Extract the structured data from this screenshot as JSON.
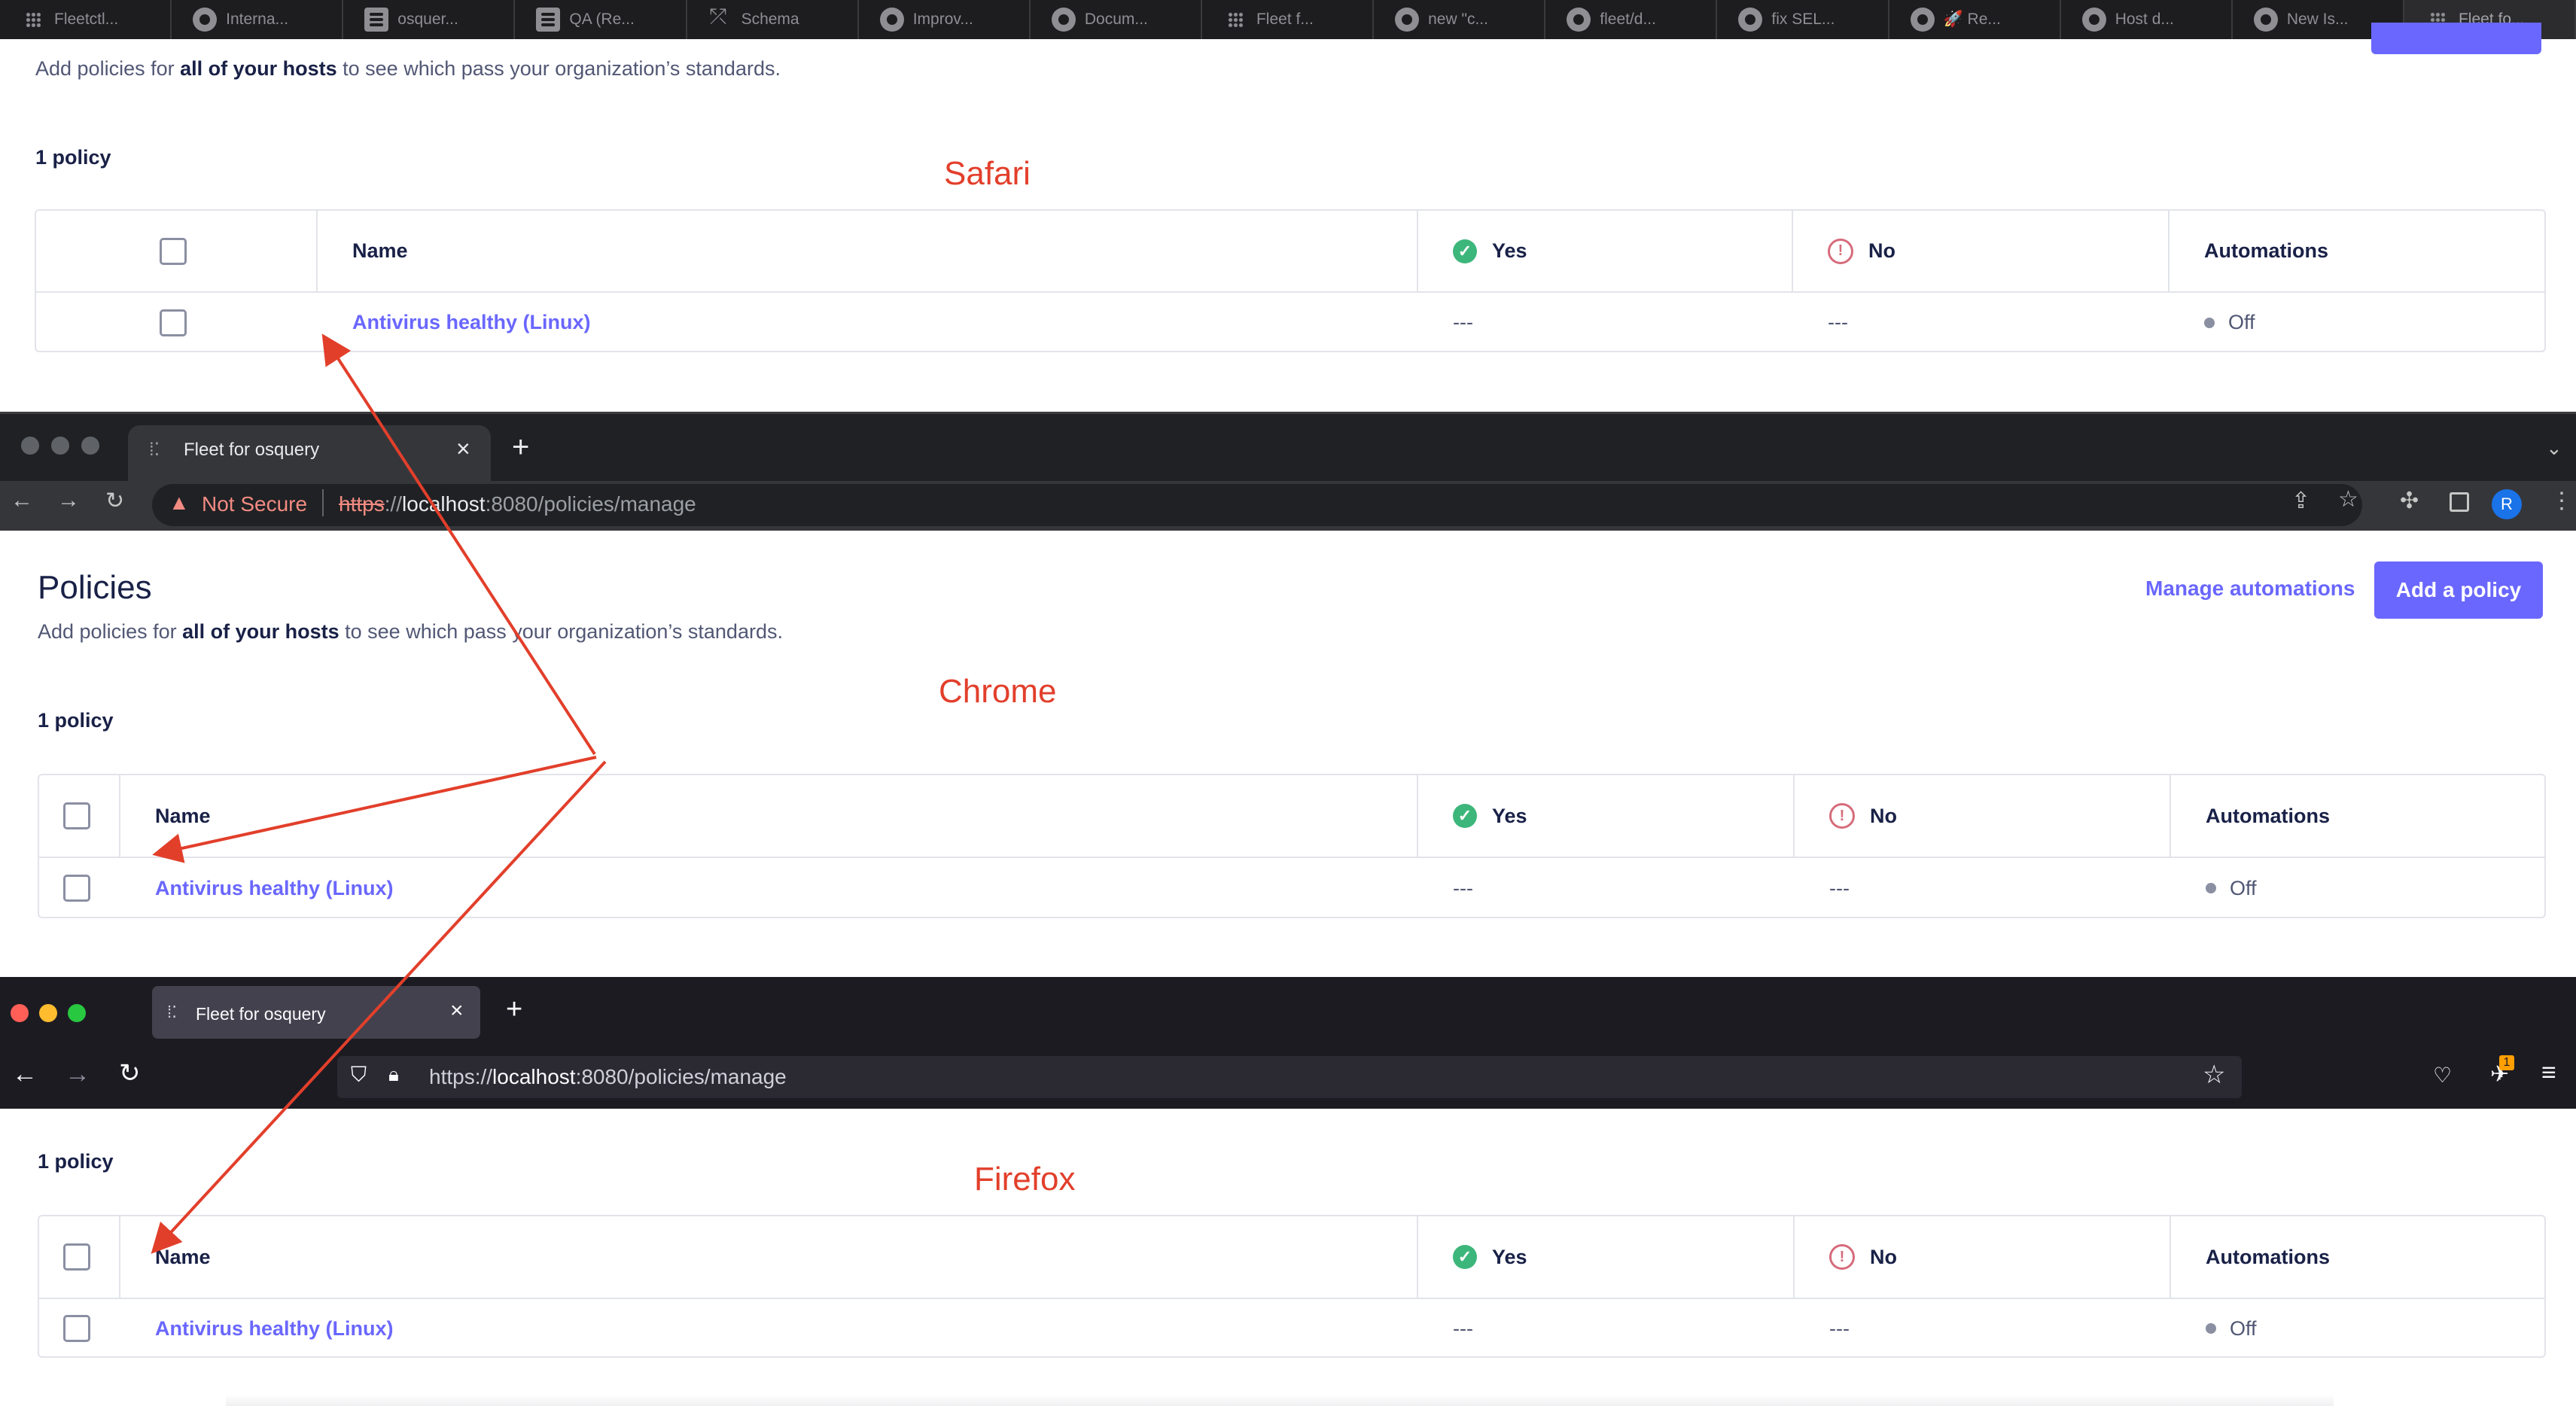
{
  "safari": {
    "tabs": [
      {
        "title": "Fleetctl...",
        "icon": "fleet-icon"
      },
      {
        "title": "Interna...",
        "icon": "github-icon"
      },
      {
        "title": "osquer...",
        "icon": "doc-icon"
      },
      {
        "title": "QA (Re...",
        "icon": "table-icon"
      },
      {
        "title": "Schema",
        "icon": "schema-icon"
      },
      {
        "title": "Improv...",
        "icon": "github-icon"
      },
      {
        "title": "Docum...",
        "icon": "github-icon"
      },
      {
        "title": "Fleet f...",
        "icon": "fleet-icon"
      },
      {
        "title": "new \"c...",
        "icon": "github-icon"
      },
      {
        "title": "fleet/d...",
        "icon": "github-icon"
      },
      {
        "title": "fix SEL...",
        "icon": "github-icon"
      },
      {
        "title": "🚀 Re...",
        "icon": "github-icon"
      },
      {
        "title": "Host d...",
        "icon": "github-icon"
      },
      {
        "title": "New Is...",
        "icon": "github-icon"
      },
      {
        "title": "Fleet fo...",
        "icon": "fleet-icon"
      }
    ],
    "subtitle_pre": "Add policies for ",
    "subtitle_bold": "all of your hosts",
    "subtitle_post": " to see which pass your organization’s standards.",
    "count": "1 policy",
    "annotation": "Safari"
  },
  "chrome": {
    "tab_title": "Fleet for osquery",
    "not_secure": "Not Secure",
    "url_scheme": "https",
    "url_sep": "://",
    "url_host": "localhost",
    "url_rest": ":8080/policies/manage",
    "avatar_letter": "R",
    "page_title": "Policies",
    "subtitle_pre": "Add policies for ",
    "subtitle_bold": "all of your hosts",
    "subtitle_post": " to see which pass your organization’s standards.",
    "manage_automations": "Manage automations",
    "add_policy": "Add a policy",
    "count": "1 policy",
    "annotation": "Chrome"
  },
  "firefox": {
    "tab_title": "Fleet for osquery",
    "url_prefix": "https://",
    "url_host": "localhost",
    "url_rest": ":8080/policies/manage",
    "badge": "1",
    "count": "1 policy",
    "annotation": "Firefox"
  },
  "table": {
    "headers": {
      "name": "Name",
      "yes": "Yes",
      "no": "No",
      "automations": "Automations"
    },
    "rows": [
      {
        "name": "Antivirus healthy (Linux)",
        "yes": "---",
        "no": "---",
        "automations": "Off"
      }
    ]
  },
  "colors": {
    "accent": "#6a67fe",
    "yes": "#3db67b",
    "no": "#d66c7b",
    "annotation": "#e23f2b"
  }
}
